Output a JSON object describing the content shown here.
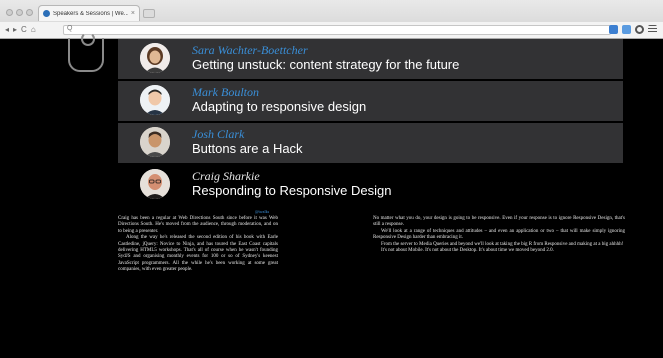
{
  "browser": {
    "tab_title": "Speakers & Sessions | We...",
    "tab_close": "×",
    "nav": {
      "back": "◂",
      "forward": "▸",
      "reload": "C",
      "home": "⌂",
      "search_glyph": "Q"
    }
  },
  "talks": [
    {
      "speaker": "Sara Wachter-Boettcher",
      "title": "Getting unstuck: content strategy for the future",
      "avatar": {
        "bg": "#f1ecea",
        "skin": "#e0b894",
        "hair": "#5b3a24"
      }
    },
    {
      "speaker": "Mark Boulton",
      "title": "Adapting to responsive design",
      "avatar": {
        "bg": "#eef2f5",
        "skin": "#f0c8a8",
        "hair": "#2d2a26"
      }
    },
    {
      "speaker": "Josh Clark",
      "title": "Buttons are a Hack",
      "avatar": {
        "bg": "#d9d4cc",
        "skin": "#c9956a",
        "hair": "#3b2c22"
      }
    },
    {
      "speaker": "Craig Sharkie",
      "title": "Responding to Responsive Design",
      "avatar": {
        "bg": "#e6e0da",
        "skin": "#d48f72",
        "hair": "#1e1b1a"
      }
    }
  ],
  "session": {
    "handle": "@twalks",
    "bio": [
      "Craig has been a regular at Web Directions South since before it was Web Directions South. He's moved from the audience, through moderation, and on to being a presenter.",
      "Along the way he's released the second edition of his book with Earle Castledine, jQuery: Novice to Ninja, and has toured the East Coast capitals delivering HTML5 workshops. That's all of course when he wasn't founding SydJS and organising monthly events for 100 or so of Sydney's keenest JavaScript programmers. All the while he's been working at some great companies, with even greater people."
    ],
    "abstract": [
      "No matter what you do, your design is going to be responsive. Even if your response is to ignore Responsive Design, that's still a response.",
      "We'll look at a range of techniques and attitudes – and even an application or two – that will make simply ignoring Responsive Design harder than embracing it.",
      "From the server to Media Queries and beyond we'll look at taking the big R from Responsive and making at a big ahhhh!",
      "It's not about Mobile. It's not about the Desktop. It's about time we moved beyond 2.0."
    ]
  },
  "colors": {
    "accent": "#3a8fd8",
    "row_bg": "#323234",
    "page_bg": "#000000"
  }
}
